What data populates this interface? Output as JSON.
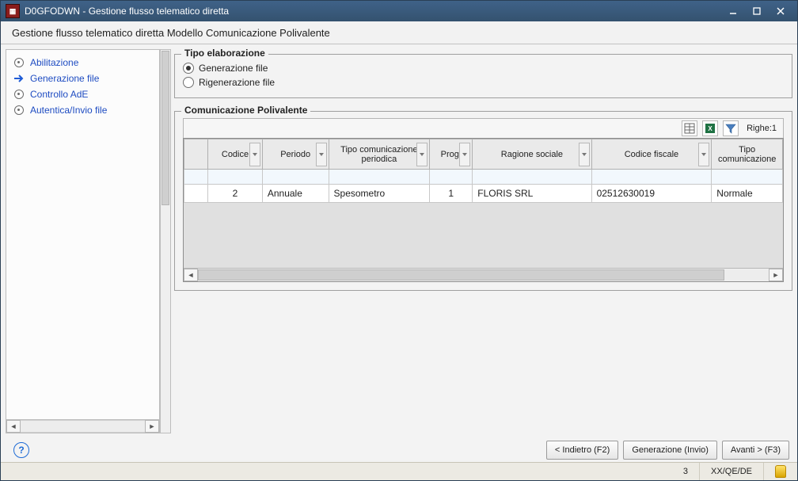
{
  "window": {
    "code": "D0GFODWN",
    "title_suffix": "Gestione flusso telematico diretta"
  },
  "subtitle": "Gestione flusso telematico diretta Modello Comunicazione Polivalente",
  "sidebar": {
    "items": [
      {
        "label": "Abilitazione",
        "active": false
      },
      {
        "label": "Generazione file",
        "active": true
      },
      {
        "label": "Controllo AdE",
        "active": false
      },
      {
        "label": "Autentica/Invio file",
        "active": false
      }
    ]
  },
  "elaborazione": {
    "legend": "Tipo elaborazione",
    "options": [
      {
        "label": "Generazione file",
        "selected": true
      },
      {
        "label": "Rigenerazione file",
        "selected": false
      }
    ]
  },
  "comunicazione": {
    "legend": "Comunicazione Polivalente",
    "rows_prefix": "Righe:",
    "rows_count": "1",
    "columns": [
      "Codice",
      "Periodo",
      "Tipo comunicazione periodica",
      "Prog.",
      "Ragione sociale",
      "Codice fiscale",
      "Tipo comunicazione"
    ],
    "row": {
      "codice": "2",
      "periodo": "Annuale",
      "tipo_periodica": "Spesometro",
      "prog": "1",
      "ragione_sociale": "FLORIS SRL",
      "codice_fiscale": "02512630019",
      "tipo_comunicazione": "Normale"
    }
  },
  "actions": {
    "back": "< Indietro (F2)",
    "generate": "Generazione (Invio)",
    "next": "Avanti > (F3)"
  },
  "status": {
    "num": "3",
    "env": "XX/QE/DE"
  }
}
